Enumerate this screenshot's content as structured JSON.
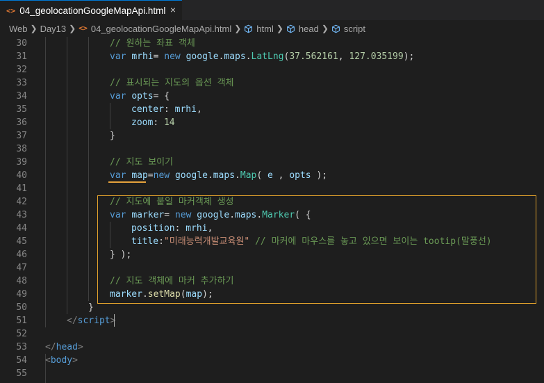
{
  "tab": {
    "icon": "<>",
    "filename": "04_geolocationGoogleMapApi.html",
    "close": "×"
  },
  "breadcrumb": {
    "web": "Web",
    "day": "Day13",
    "file_icon": "<>",
    "file": "04_geolocationGoogleMapApi.html",
    "html": "html",
    "head": "head",
    "script": "script"
  },
  "line_numbers": [
    "30",
    "31",
    "32",
    "33",
    "34",
    "35",
    "36",
    "37",
    "38",
    "39",
    "40",
    "41",
    "42",
    "43",
    "44",
    "45",
    "46",
    "47",
    "48",
    "49",
    "50",
    "51",
    "52",
    "53",
    "54",
    "55"
  ],
  "code": {
    "l30": "// 원하는 좌표 객체",
    "l31": {
      "kw": "var",
      "name": "mrhi",
      "eq": "= ",
      "new": "new",
      "obj": "google",
      "d1": ".",
      "mod": "maps",
      "d2": ".",
      "cls": "LatLng",
      "open": "(",
      "n1": "37.562161",
      "comma": ", ",
      "n2": "127.035199",
      "close": ");"
    },
    "l33": "// 표시되는 지도의 옵션 객체",
    "l34": {
      "kw": "var",
      "name": "opts",
      "rest": "= {"
    },
    "l35": {
      "key": "center",
      "colon": ": ",
      "val": "mrhi",
      "comma": ","
    },
    "l36": {
      "key": "zoom",
      "colon": ": ",
      "num": "14"
    },
    "l37": "}",
    "l39": "// 지도 보이기",
    "l40": {
      "kw": "var",
      "name": "map",
      "eq": "=",
      "new": "new",
      "obj": "google",
      "d1": ".",
      "mod": "maps",
      "d2": ".",
      "cls": "Map",
      "open": "( ",
      "arg1": "e",
      "comma": " , ",
      "arg2": "opts",
      "close": " );"
    },
    "l42": "// 지도에 붙일 마커객체 생성",
    "l43": {
      "kw": "var",
      "name": "marker",
      "eq": "= ",
      "new": "new",
      "obj": "google",
      "d1": ".",
      "mod": "maps",
      "d2": ".",
      "cls": "Marker",
      "open": "( {"
    },
    "l44": {
      "key": "position",
      "colon": ": ",
      "val": "mrhi",
      "comma": ","
    },
    "l45": {
      "key": "title",
      "colon": ":",
      "str": "\"미래능력개발교육원\"",
      "comment": "// 마커에 마우스를 놓고 있으면 보이는 tootip(말풍선)"
    },
    "l46": "} );",
    "l48": "// 지도 객체에 마커 추가하기",
    "l49": {
      "obj": "marker",
      "dot": ".",
      "fn": "setMap",
      "open": "(",
      "arg": "map",
      "close": ");"
    },
    "l50": "}",
    "l51": {
      "lt": "</",
      "tag": "script",
      "gt": ">"
    },
    "l53": {
      "lt": "</",
      "tag": "head",
      "gt": ">"
    },
    "l54": {
      "lt": "<",
      "tag": "body",
      "gt": ">"
    }
  },
  "colors": {
    "highlight_box": "#e2a22c",
    "underline": "#e6a23c",
    "tab_accent": "#0078d4",
    "html_icon": "#e37933"
  },
  "icons": {
    "tab": "html-file-icon",
    "close": "close-icon",
    "chevron": "chevron-right-icon",
    "element": "cube-icon"
  }
}
